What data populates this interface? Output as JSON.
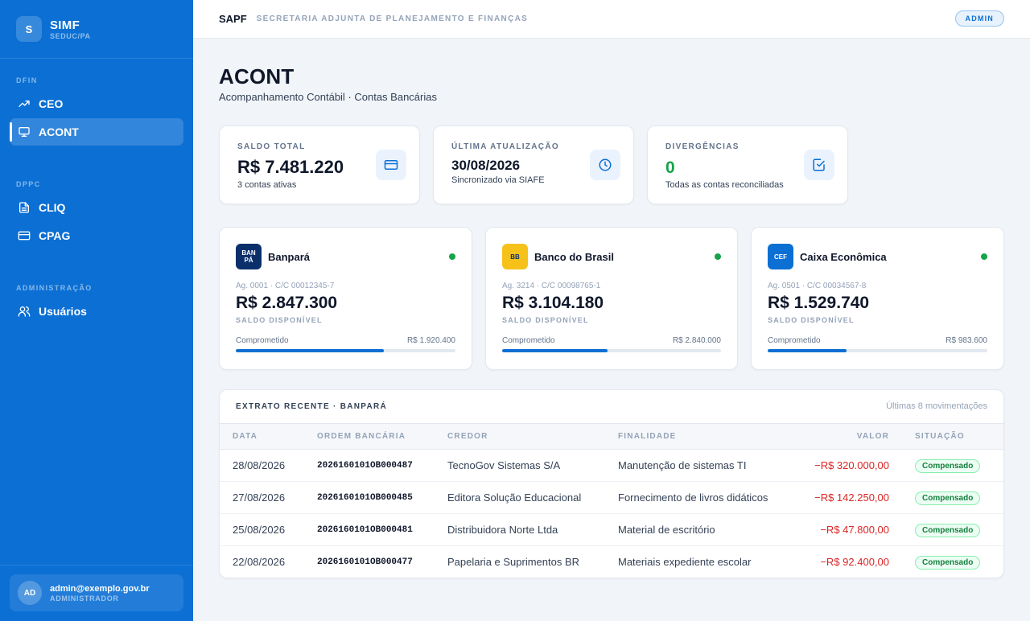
{
  "sidebar": {
    "brand_badge": "S",
    "brand_title": "SIMF",
    "brand_sub": "SEDUC/PA",
    "sections": [
      "DFIN",
      "DPPC",
      "ADMINISTRAÇÃO"
    ],
    "items": [
      {
        "label": "CEO",
        "icon": "trend-up-icon"
      },
      {
        "label": "ACONT",
        "icon": "monitor-icon",
        "active": true
      },
      {
        "label": "CLIQ",
        "icon": "document-icon"
      },
      {
        "label": "CPAG",
        "icon": "card-icon"
      },
      {
        "label": "Usuários",
        "icon": "users-icon"
      }
    ],
    "user": {
      "initials": "AD",
      "email": "admin@exemplo.gov.br",
      "role": "ADMINISTRADOR"
    }
  },
  "topbar": {
    "title": "SAPF",
    "subtitle": "SECRETARIA ADJUNTA DE PLANEJAMENTO E FINANÇAS",
    "badge": "ADMIN"
  },
  "header": {
    "title": "ACONT",
    "subtitle": "Acompanhamento Contábil · Contas Bancárias"
  },
  "stats": [
    {
      "label": "SALDO TOTAL",
      "value": "R$ 7.481.220",
      "note": "3 contas ativas",
      "icon": "card-icon"
    },
    {
      "label": "ÚLTIMA ATUALIZAÇÃO",
      "value": "30/08/2026",
      "note": "Sincronizado via SIAFE",
      "icon": "clock-icon"
    },
    {
      "label": "DIVERGÊNCIAS",
      "value": "0",
      "note": "Todas as contas reconciliadas",
      "icon": "check-square-icon"
    }
  ],
  "banks": [
    {
      "logo": "BAN PÁ",
      "name": "Banpará",
      "account": "Ag. 0001 · C/C 00012345-7",
      "balance": "R$ 2.847.300",
      "balance_label": "SALDO DISPONÍVEL",
      "committed_label": "Comprometido",
      "committed": "R$ 1.920.400",
      "committed_fraction": 0.674,
      "logo_bg": "#0b2f6b",
      "logo_fg": "#ffffff"
    },
    {
      "logo": "BB",
      "name": "Banco do Brasil",
      "account": "Ag. 3214 · C/C 00098765-1",
      "balance": "R$ 3.104.180",
      "balance_label": "SALDO DISPONÍVEL",
      "committed_label": "Comprometido",
      "committed": "R$ 2.840.000",
      "committed_fraction": 0.48,
      "logo_bg": "#f6c21a",
      "logo_fg": "#0b2f6b"
    },
    {
      "logo": "CEF",
      "name": "Caixa Econômica",
      "account": "Ag. 0501 · C/C 00034567-8",
      "balance": "R$ 1.529.740",
      "balance_label": "SALDO DISPONÍVEL",
      "committed_label": "Comprometido",
      "committed": "R$ 983.600",
      "committed_fraction": 0.36,
      "logo_bg": "#0b6fd4",
      "logo_fg": "#ffffff"
    }
  ],
  "statement": {
    "title": "EXTRATO RECENTE · BANPARÁ",
    "note": "Últimas 8 movimentações",
    "columns": [
      "DATA",
      "ORDEM BANCÁRIA",
      "CREDOR",
      "FINALIDADE",
      "VALOR",
      "SITUAÇÃO"
    ],
    "rows": [
      {
        "date": "28/08/2026",
        "order": "2026160101OB000487",
        "creditor": "TecnoGov Sistemas S/A",
        "purpose": "Manutenção de sistemas TI",
        "value": "−R$ 320.000,00",
        "status": "Compensado"
      },
      {
        "date": "27/08/2026",
        "order": "2026160101OB000485",
        "creditor": "Editora Solução Educacional",
        "purpose": "Fornecimento de livros didáticos",
        "value": "−R$ 142.250,00",
        "status": "Compensado"
      },
      {
        "date": "25/08/2026",
        "order": "2026160101OB000481",
        "creditor": "Distribuidora Norte Ltda",
        "purpose": "Material de escritório",
        "value": "−R$ 47.800,00",
        "status": "Compensado"
      },
      {
        "date": "22/08/2026",
        "order": "2026160101OB000477",
        "creditor": "Papelaria e Suprimentos BR",
        "purpose": "Materiais expediente escolar",
        "value": "−R$ 92.400,00",
        "status": "Compensado"
      }
    ]
  },
  "colors": {
    "primary": "#0b6fd4",
    "success": "#16a34a",
    "negative": "#dc2626"
  }
}
